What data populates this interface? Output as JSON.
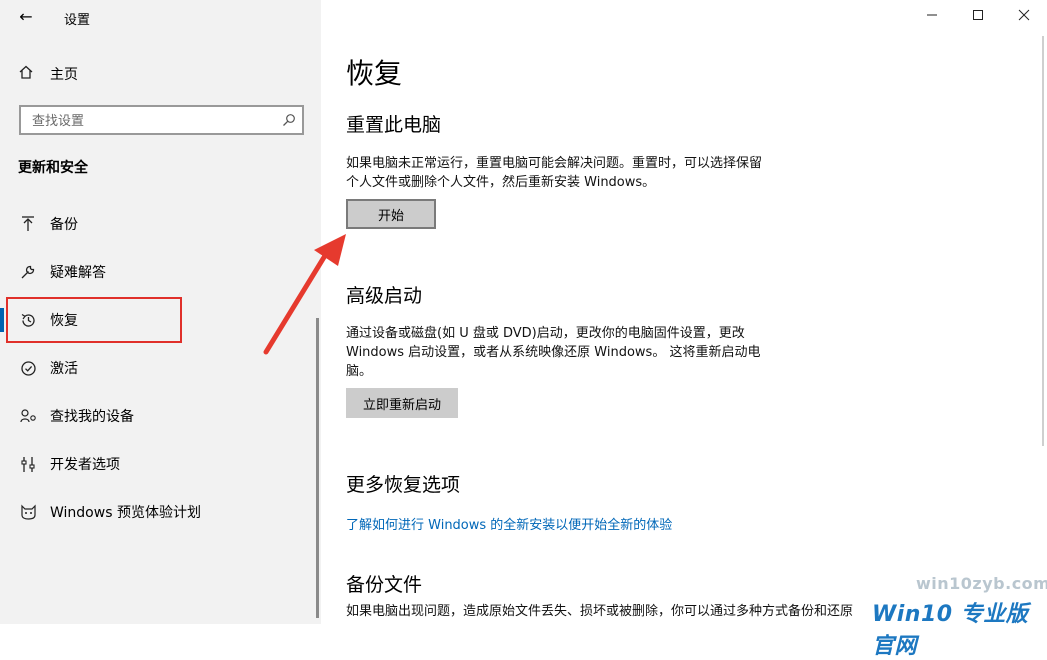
{
  "sidebar": {
    "app_title": "设置",
    "home_label": "主页",
    "search_placeholder": "查找设置",
    "section_title": "更新和安全",
    "items": [
      {
        "label": "备份",
        "icon": "backup-arrow-icon"
      },
      {
        "label": "疑难解答",
        "icon": "wrench-icon"
      },
      {
        "label": "恢复",
        "icon": "history-icon",
        "selected": true
      },
      {
        "label": "激活",
        "icon": "checkmark-circle-icon"
      },
      {
        "label": "查找我的设备",
        "icon": "person-location-icon"
      },
      {
        "label": "开发者选项",
        "icon": "developer-icon"
      },
      {
        "label": "Windows 预览体验计划",
        "icon": "cat-icon"
      }
    ]
  },
  "main": {
    "page_title": "恢复",
    "reset": {
      "heading": "重置此电脑",
      "line1": "如果电脑未正常运行，重置电脑可能会解决问题。重置时，可以选择保留",
      "line2": "个人文件或删除个人文件，然后重新安装 Windows。",
      "button": "开始"
    },
    "advanced": {
      "heading": "高级启动",
      "line1": "通过设备或磁盘(如 U 盘或 DVD)启动，更改你的电脑固件设置，更改",
      "line2": "Windows 启动设置，或者从系统映像还原 Windows。 这将重新启动电",
      "line3": "脑。",
      "button": "立即重新启动"
    },
    "more": {
      "heading": "更多恢复选项",
      "link": "了解如何进行 Windows 的全新安装以便开始全新的体验"
    },
    "backup": {
      "heading": "备份文件",
      "line1": "如果电脑出现问题，造成原始文件丢失、损坏或被删除，你可以通过多种方式备份和还原"
    }
  },
  "watermark": {
    "small": "win10zyb.com",
    "big": "Win10 专业版官网"
  },
  "colors": {
    "accent": "#0063b1",
    "link": "#0067b8",
    "highlight": "#e0302a",
    "arrow": "#e63a2e"
  }
}
